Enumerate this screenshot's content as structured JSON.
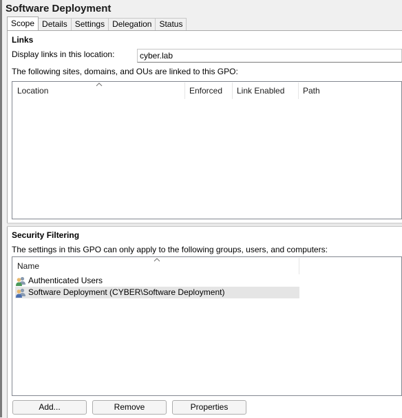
{
  "window": {
    "title": "Software Deployment"
  },
  "tabs": [
    {
      "label": "Scope",
      "active": true
    },
    {
      "label": "Details",
      "active": false
    },
    {
      "label": "Settings",
      "active": false
    },
    {
      "label": "Delegation",
      "active": false
    },
    {
      "label": "Status",
      "active": false
    }
  ],
  "links": {
    "heading": "Links",
    "display_label": "Display links in this location:",
    "location_value": "cyber.lab",
    "description": "The following sites, domains, and OUs are linked to this GPO:",
    "columns": [
      "Location",
      "Enforced",
      "Link Enabled",
      "Path"
    ],
    "rows": []
  },
  "security_filtering": {
    "heading": "Security Filtering",
    "description": "The settings in this GPO can only apply to the following groups, users, and computers:",
    "column": "Name",
    "rows": [
      {
        "name": "Authenticated Users",
        "icon": "user-group-icon",
        "selected": false
      },
      {
        "name": "Software Deployment (CYBER\\Software Deployment)",
        "icon": "user-group-icon",
        "selected": true
      }
    ]
  },
  "buttons": {
    "add": "Add...",
    "remove": "Remove",
    "properties": "Properties"
  },
  "colors": {
    "selection": "#e5e5e5",
    "border": "#828790",
    "background": "#f0f0f0"
  }
}
